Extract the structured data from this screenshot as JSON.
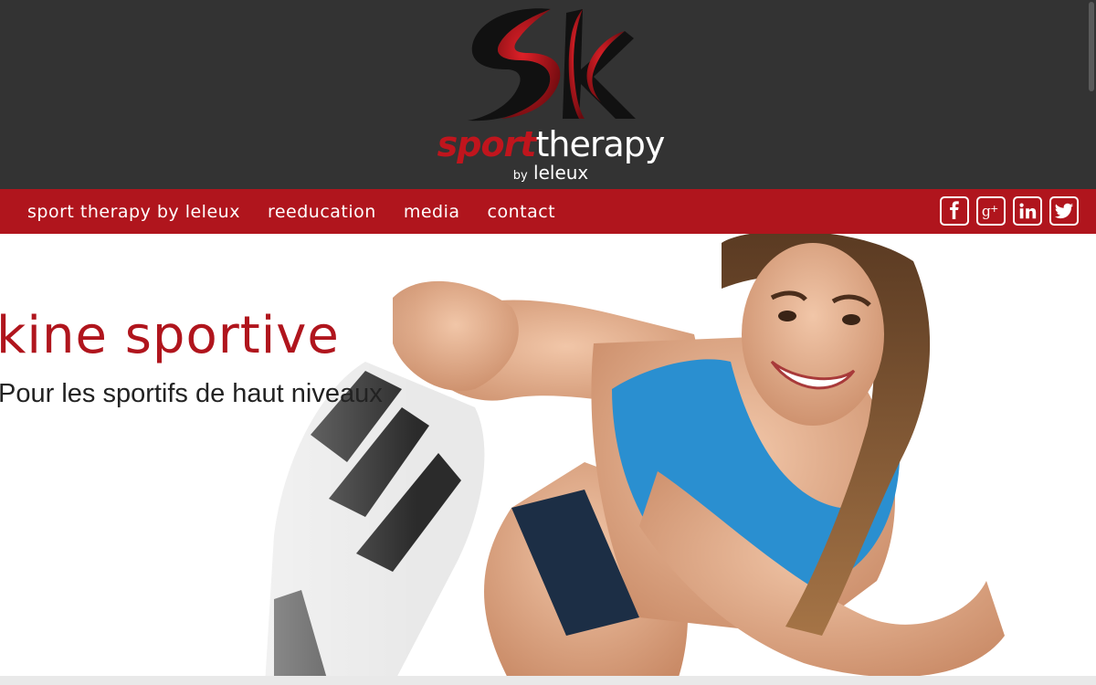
{
  "header": {
    "logo": {
      "monogram": "sk",
      "word_part1": "sport",
      "word_part2": "therapy",
      "by": "by",
      "name": "leleux",
      "colors": {
        "red": "#c0151d",
        "white": "#ffffff",
        "black": "#111111"
      }
    },
    "background": "#333333"
  },
  "nav": {
    "items": [
      {
        "label": "sport therapy by leleux"
      },
      {
        "label": "reeducation"
      },
      {
        "label": "media"
      },
      {
        "label": "contact"
      }
    ],
    "social": [
      {
        "icon": "facebook-icon"
      },
      {
        "icon": "google-plus-icon"
      },
      {
        "icon": "linkedin-icon"
      },
      {
        "icon": "twitter-icon"
      }
    ],
    "background": "#b0151d"
  },
  "hero": {
    "title": "kine sportive",
    "subtitle": "Pour les sportifs de haut niveaux",
    "image": "woman-stretching-photo"
  }
}
